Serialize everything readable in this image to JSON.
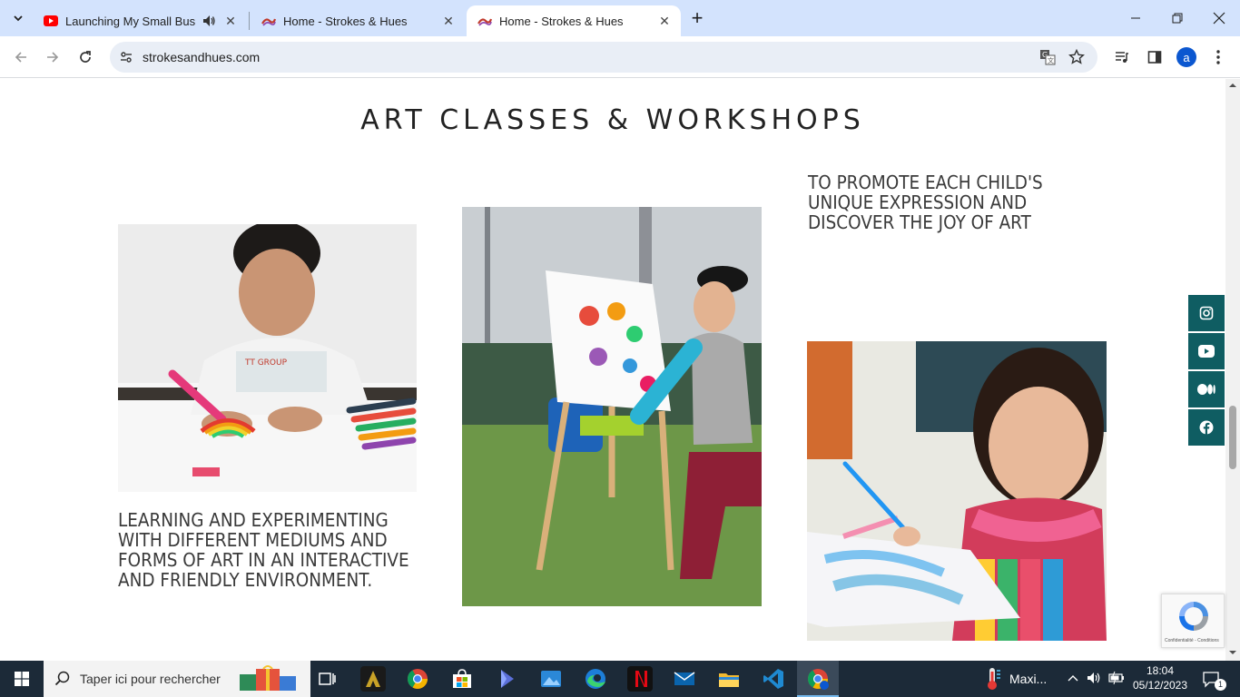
{
  "browser": {
    "tabs": [
      {
        "title": "Launching My Small Busine",
        "favicon": "youtube-icon",
        "audio": true
      },
      {
        "title": "Home - Strokes & Hues",
        "favicon": "strokes-hues-icon"
      },
      {
        "title": "Home - Strokes & Hues",
        "favicon": "strokes-hues-icon",
        "active": true
      }
    ],
    "new_tab": "+",
    "url": "strokesandhues.com",
    "profile_initial": "a"
  },
  "page": {
    "title": "ART CLASSES & WORKSHOPS",
    "caption_left": "LEARNING AND EXPERIMENTING WITH DIFFERENT MEDIUMS AND FORMS OF ART IN AN INTERACTIVE AND FRIENDLY ENVIRONMENT.",
    "caption_right": "TO PROMOTE EACH CHILD'S UNIQUE EXPRESSION AND DISCOVER THE JOY OF ART",
    "social": [
      "instagram-icon",
      "youtube-icon",
      "medium-icon",
      "facebook-icon"
    ],
    "recaptcha": "Confidentialité - Conditions"
  },
  "taskbar": {
    "search_placeholder": "Taper ici pour rechercher",
    "weather": "Maxi...",
    "time": "18:04",
    "date": "05/12/2023",
    "notification_count": "1"
  },
  "colors": {
    "accent": "#0f5d62",
    "tabstrip": "#d3e3fd",
    "taskbar": "#1c2a38"
  }
}
